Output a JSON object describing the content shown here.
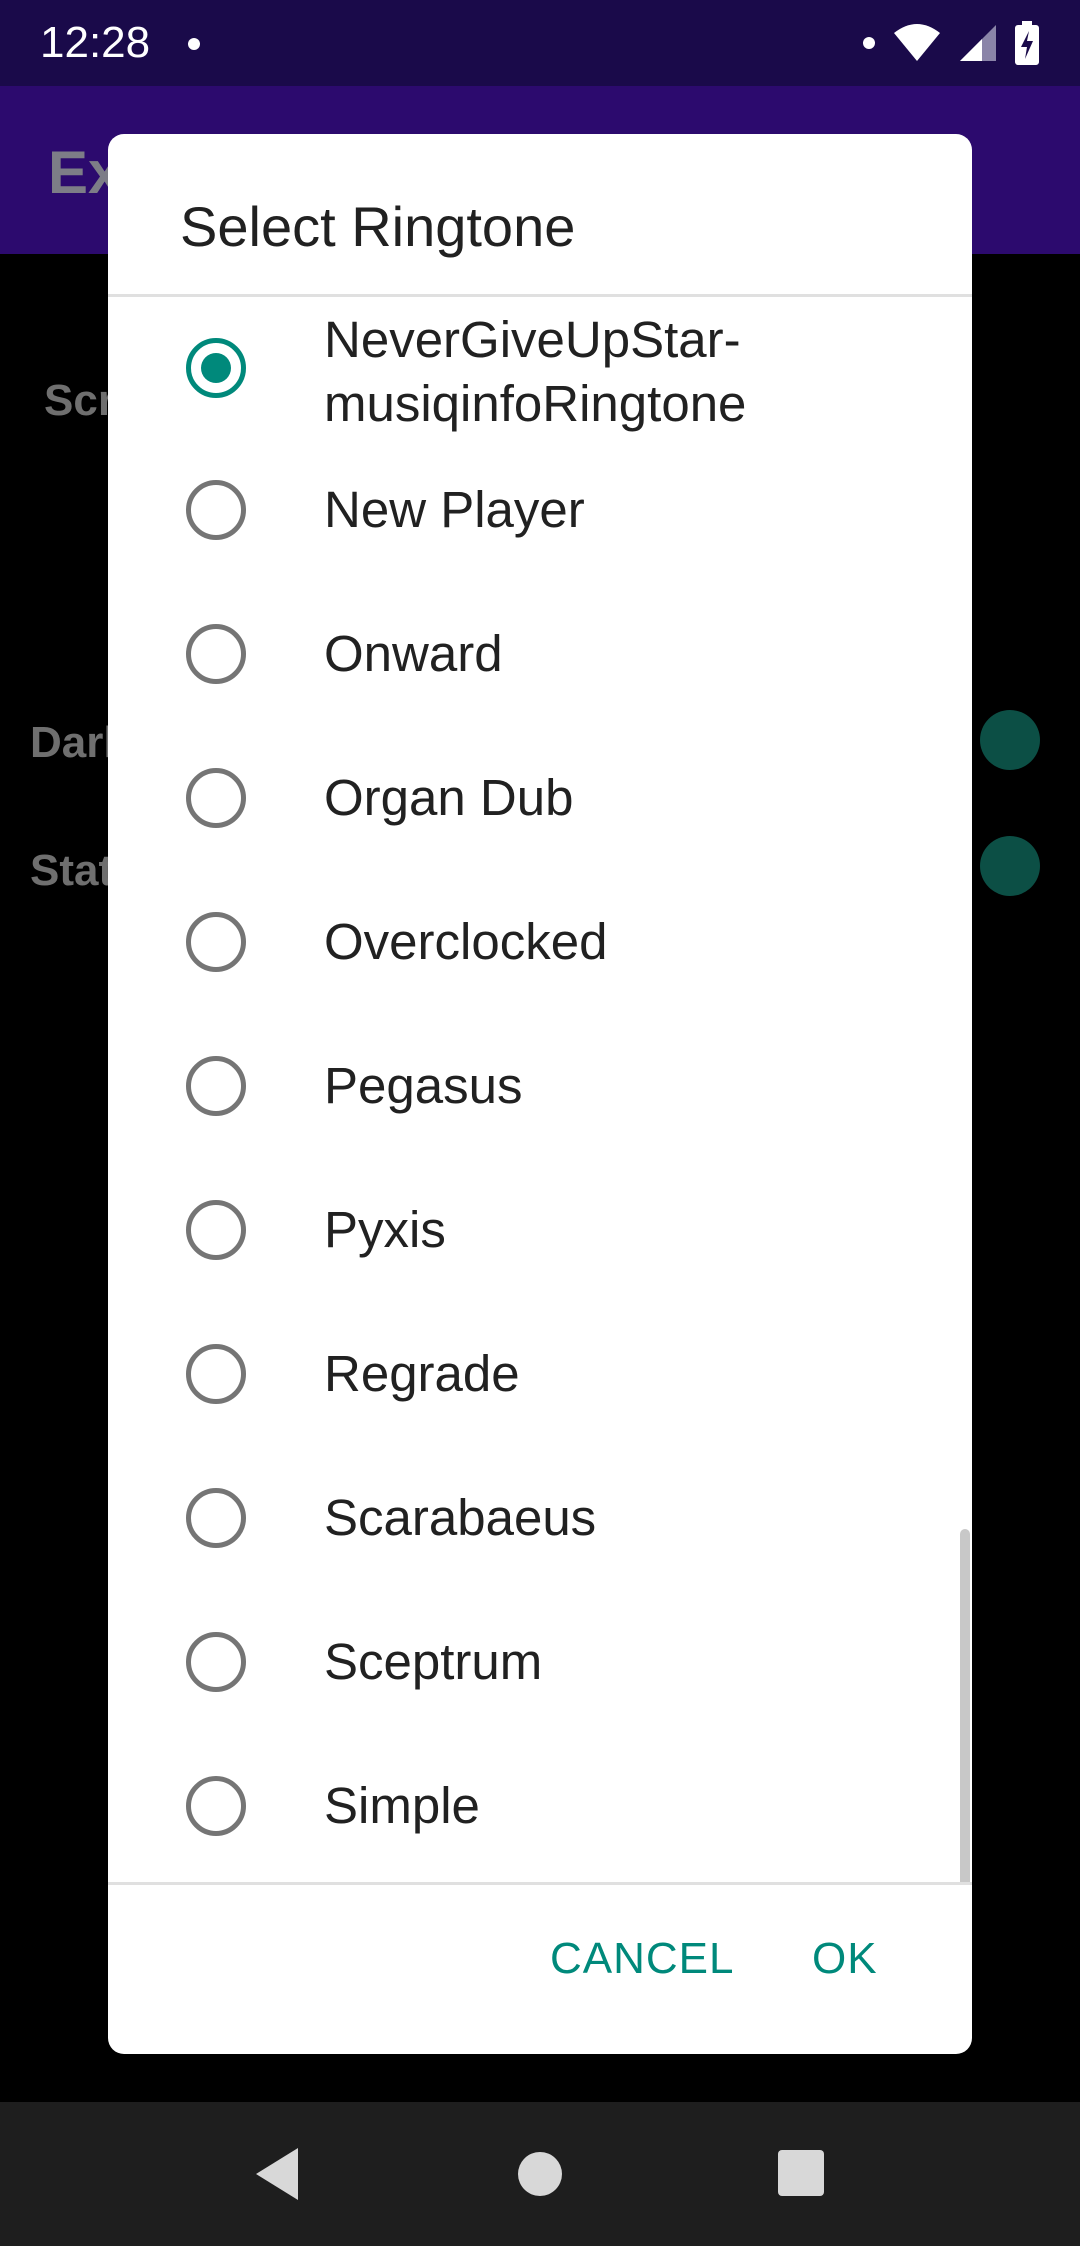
{
  "status_bar": {
    "time": "12:28"
  },
  "app_bar": {
    "title_fragment": "Ex"
  },
  "background": {
    "items": [
      "Scr",
      "Darl",
      "Stat"
    ]
  },
  "dialog": {
    "title": "Select Ringtone",
    "options": [
      {
        "label": "NeverGiveUpStar-\nmusiqinfoRingtone",
        "selected": true
      },
      {
        "label": "New Player",
        "selected": false
      },
      {
        "label": "Onward",
        "selected": false
      },
      {
        "label": "Organ Dub",
        "selected": false
      },
      {
        "label": "Overclocked",
        "selected": false
      },
      {
        "label": "Pegasus",
        "selected": false
      },
      {
        "label": "Pyxis",
        "selected": false
      },
      {
        "label": "Regrade",
        "selected": false
      },
      {
        "label": "Scarabaeus",
        "selected": false
      },
      {
        "label": "Sceptrum",
        "selected": false
      },
      {
        "label": "Simple",
        "selected": false
      }
    ],
    "cancel_label": "CANCEL",
    "ok_label": "OK"
  },
  "colors": {
    "accent": "#00897b",
    "status_bar": "#1a0a4a",
    "app_bar": "#2c0a6e"
  }
}
